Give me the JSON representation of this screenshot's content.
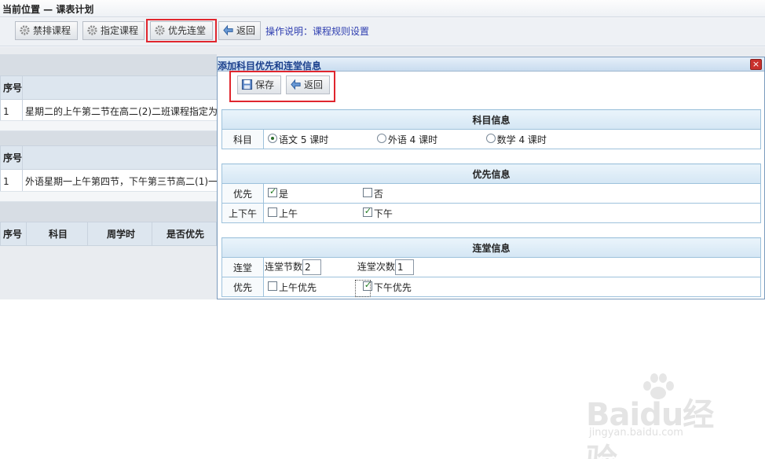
{
  "page": {
    "breadcrumb": "当前位置 — 课表计划"
  },
  "toolbar": {
    "buttons": [
      {
        "label": "禁排课程",
        "icon": "gear-icon"
      },
      {
        "label": "指定课程",
        "icon": "gear-icon"
      },
      {
        "label": "优先连堂",
        "icon": "gear-icon"
      },
      {
        "label": "返回",
        "icon": "back-arrow-icon"
      }
    ],
    "help_link": "操作说明：课程规则设置"
  },
  "background": {
    "table1": {
      "header": [
        "序号",
        ""
      ],
      "rows": [
        [
          "1",
          "星期二的上午第二节在高二(2)二班课程指定为"
        ]
      ]
    },
    "table2": {
      "header": [
        "序号",
        ""
      ],
      "rows": [
        [
          "1",
          "外语星期一上午第四节，下午第三节高二(1)一"
        ]
      ]
    },
    "table3": {
      "header": [
        "序号",
        "科目",
        "周学时",
        "是否优先"
      ]
    }
  },
  "dialog": {
    "title": "添加科目优先和连堂信息",
    "close": "×",
    "buttons": [
      {
        "label": "保存",
        "icon": "save-disk-icon"
      },
      {
        "label": "返回",
        "icon": "back-arrow-icon"
      }
    ],
    "subject_section": {
      "header": "科目信息",
      "label": "科目",
      "options": [
        {
          "text": "语文  5 课时",
          "selected": true
        },
        {
          "text": "外语  4 课时",
          "selected": false
        },
        {
          "text": "数学  4 课时",
          "selected": false
        }
      ]
    },
    "priority_section": {
      "header": "优先信息",
      "rows": [
        {
          "label": "优先",
          "options": [
            {
              "text": "是",
              "checked": true
            },
            {
              "text": "否",
              "checked": false
            }
          ]
        },
        {
          "label": "上下午",
          "options": [
            {
              "text": "上午",
              "checked": false
            },
            {
              "text": "下午",
              "checked": true
            }
          ]
        }
      ]
    },
    "continuous_section": {
      "header": "连堂信息",
      "label_continuous": "连堂",
      "lessons_label": "连堂节数",
      "lessons_value": "2",
      "times_label": "连堂次数",
      "times_value": "1",
      "label_priority": "优先",
      "options": [
        {
          "text": "上午优先",
          "checked": false
        },
        {
          "text": "下午优先",
          "checked": true
        }
      ]
    }
  },
  "watermark": {
    "big": "Baidu经验",
    "small": "jingyan.baidu.com"
  },
  "colors": {
    "highlight": "#e0262e",
    "link": "#2f3fb0",
    "dialog_title": "#1a3f8c"
  }
}
